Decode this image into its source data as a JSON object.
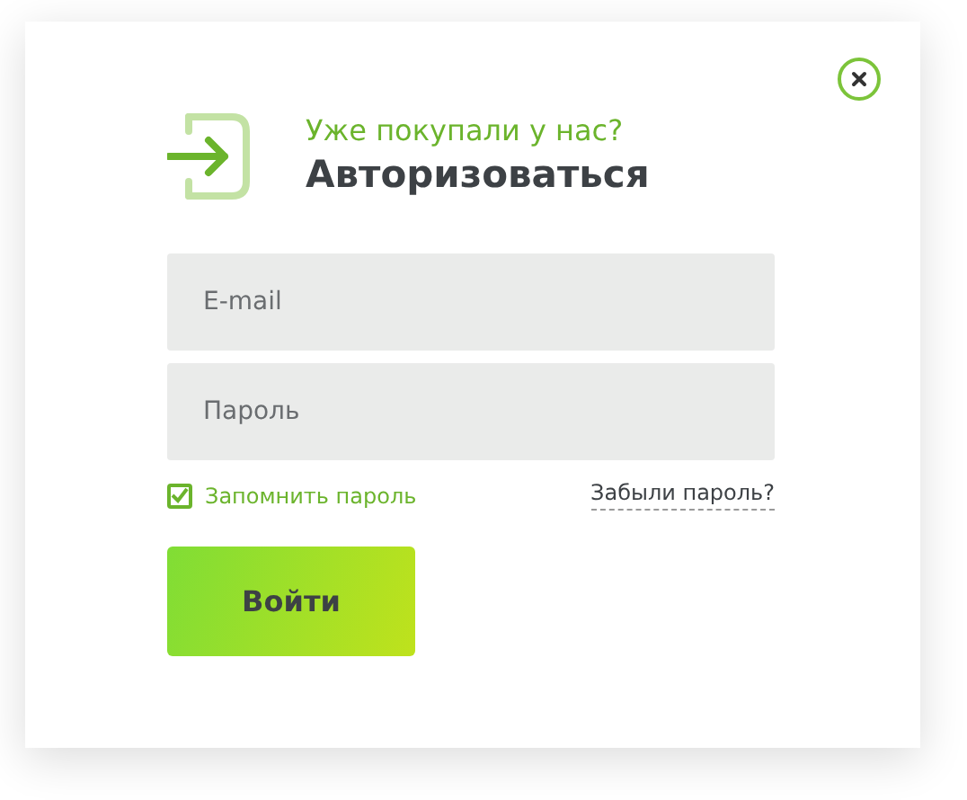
{
  "dialog": {
    "subtitle": "Уже покупали у нас?",
    "title": "Авторизоваться"
  },
  "fields": [
    {
      "placeholder": "E-mail"
    },
    {
      "placeholder": "Пароль"
    }
  ],
  "remember": {
    "label": "Запомнить пароль",
    "checked": true
  },
  "forgot_link": "Забыли пароль?",
  "submit_button": "Войти"
}
